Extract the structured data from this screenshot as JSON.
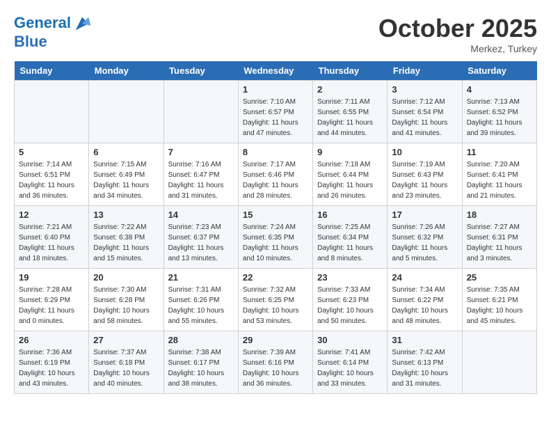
{
  "header": {
    "logo_line1": "General",
    "logo_line2": "Blue",
    "month": "October 2025",
    "location": "Merkez, Turkey"
  },
  "days_of_week": [
    "Sunday",
    "Monday",
    "Tuesday",
    "Wednesday",
    "Thursday",
    "Friday",
    "Saturday"
  ],
  "weeks": [
    [
      {
        "day": "",
        "info": ""
      },
      {
        "day": "",
        "info": ""
      },
      {
        "day": "",
        "info": ""
      },
      {
        "day": "1",
        "info": "Sunrise: 7:10 AM\nSunset: 6:57 PM\nDaylight: 11 hours\nand 47 minutes."
      },
      {
        "day": "2",
        "info": "Sunrise: 7:11 AM\nSunset: 6:55 PM\nDaylight: 11 hours\nand 44 minutes."
      },
      {
        "day": "3",
        "info": "Sunrise: 7:12 AM\nSunset: 6:54 PM\nDaylight: 11 hours\nand 41 minutes."
      },
      {
        "day": "4",
        "info": "Sunrise: 7:13 AM\nSunset: 6:52 PM\nDaylight: 11 hours\nand 39 minutes."
      }
    ],
    [
      {
        "day": "5",
        "info": "Sunrise: 7:14 AM\nSunset: 6:51 PM\nDaylight: 11 hours\nand 36 minutes."
      },
      {
        "day": "6",
        "info": "Sunrise: 7:15 AM\nSunset: 6:49 PM\nDaylight: 11 hours\nand 34 minutes."
      },
      {
        "day": "7",
        "info": "Sunrise: 7:16 AM\nSunset: 6:47 PM\nDaylight: 11 hours\nand 31 minutes."
      },
      {
        "day": "8",
        "info": "Sunrise: 7:17 AM\nSunset: 6:46 PM\nDaylight: 11 hours\nand 28 minutes."
      },
      {
        "day": "9",
        "info": "Sunrise: 7:18 AM\nSunset: 6:44 PM\nDaylight: 11 hours\nand 26 minutes."
      },
      {
        "day": "10",
        "info": "Sunrise: 7:19 AM\nSunset: 6:43 PM\nDaylight: 11 hours\nand 23 minutes."
      },
      {
        "day": "11",
        "info": "Sunrise: 7:20 AM\nSunset: 6:41 PM\nDaylight: 11 hours\nand 21 minutes."
      }
    ],
    [
      {
        "day": "12",
        "info": "Sunrise: 7:21 AM\nSunset: 6:40 PM\nDaylight: 11 hours\nand 18 minutes."
      },
      {
        "day": "13",
        "info": "Sunrise: 7:22 AM\nSunset: 6:38 PM\nDaylight: 11 hours\nand 15 minutes."
      },
      {
        "day": "14",
        "info": "Sunrise: 7:23 AM\nSunset: 6:37 PM\nDaylight: 11 hours\nand 13 minutes."
      },
      {
        "day": "15",
        "info": "Sunrise: 7:24 AM\nSunset: 6:35 PM\nDaylight: 11 hours\nand 10 minutes."
      },
      {
        "day": "16",
        "info": "Sunrise: 7:25 AM\nSunset: 6:34 PM\nDaylight: 11 hours\nand 8 minutes."
      },
      {
        "day": "17",
        "info": "Sunrise: 7:26 AM\nSunset: 6:32 PM\nDaylight: 11 hours\nand 5 minutes."
      },
      {
        "day": "18",
        "info": "Sunrise: 7:27 AM\nSunset: 6:31 PM\nDaylight: 11 hours\nand 3 minutes."
      }
    ],
    [
      {
        "day": "19",
        "info": "Sunrise: 7:28 AM\nSunset: 6:29 PM\nDaylight: 11 hours\nand 0 minutes."
      },
      {
        "day": "20",
        "info": "Sunrise: 7:30 AM\nSunset: 6:28 PM\nDaylight: 10 hours\nand 58 minutes."
      },
      {
        "day": "21",
        "info": "Sunrise: 7:31 AM\nSunset: 6:26 PM\nDaylight: 10 hours\nand 55 minutes."
      },
      {
        "day": "22",
        "info": "Sunrise: 7:32 AM\nSunset: 6:25 PM\nDaylight: 10 hours\nand 53 minutes."
      },
      {
        "day": "23",
        "info": "Sunrise: 7:33 AM\nSunset: 6:23 PM\nDaylight: 10 hours\nand 50 minutes."
      },
      {
        "day": "24",
        "info": "Sunrise: 7:34 AM\nSunset: 6:22 PM\nDaylight: 10 hours\nand 48 minutes."
      },
      {
        "day": "25",
        "info": "Sunrise: 7:35 AM\nSunset: 6:21 PM\nDaylight: 10 hours\nand 45 minutes."
      }
    ],
    [
      {
        "day": "26",
        "info": "Sunrise: 7:36 AM\nSunset: 6:19 PM\nDaylight: 10 hours\nand 43 minutes."
      },
      {
        "day": "27",
        "info": "Sunrise: 7:37 AM\nSunset: 6:18 PM\nDaylight: 10 hours\nand 40 minutes."
      },
      {
        "day": "28",
        "info": "Sunrise: 7:38 AM\nSunset: 6:17 PM\nDaylight: 10 hours\nand 38 minutes."
      },
      {
        "day": "29",
        "info": "Sunrise: 7:39 AM\nSunset: 6:16 PM\nDaylight: 10 hours\nand 36 minutes."
      },
      {
        "day": "30",
        "info": "Sunrise: 7:41 AM\nSunset: 6:14 PM\nDaylight: 10 hours\nand 33 minutes."
      },
      {
        "day": "31",
        "info": "Sunrise: 7:42 AM\nSunset: 6:13 PM\nDaylight: 10 hours\nand 31 minutes."
      },
      {
        "day": "",
        "info": ""
      }
    ]
  ]
}
